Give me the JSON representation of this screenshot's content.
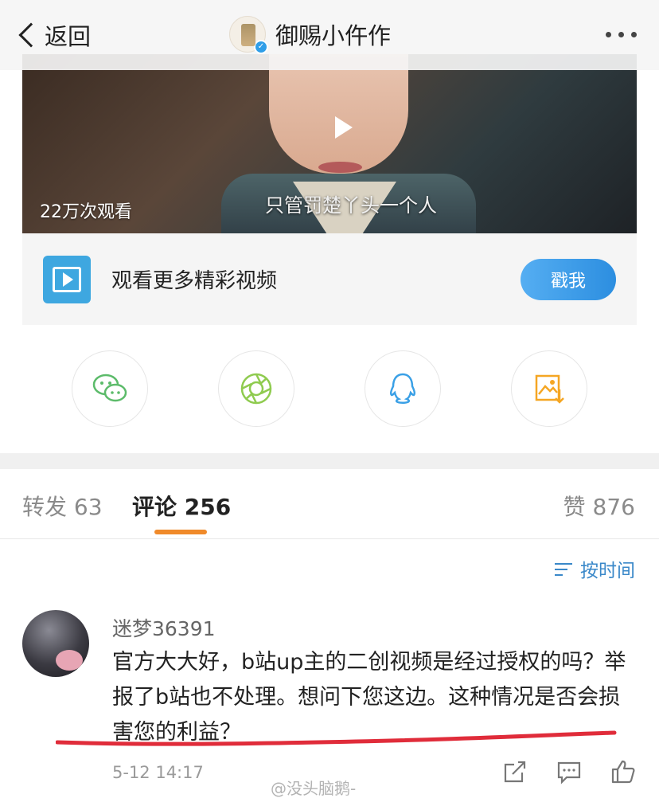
{
  "header": {
    "back_label": "返回",
    "profile_name": "御赐小仵作",
    "avatar_icon": "verified-avatar-icon",
    "more_icon": "more-dots-icon"
  },
  "video": {
    "views": "22万次观看",
    "subtitle": "只管罚楚丫头一个人"
  },
  "promo": {
    "label": "观看更多精彩视频",
    "button": "戳我",
    "icon": "video-icon",
    "accent": "#3ea7e0"
  },
  "share": {
    "items": [
      {
        "icon": "wechat-icon",
        "color": "#5cbb6a"
      },
      {
        "icon": "moments-icon",
        "color": "#8fcb4f"
      },
      {
        "icon": "qq-icon",
        "color": "#3aa0e6"
      },
      {
        "icon": "save-image-icon",
        "color": "#f5a623"
      }
    ]
  },
  "tabs": {
    "repost": "转发 63",
    "comments": "评论 256",
    "likes": "赞 876",
    "active_color": "#f08a2a"
  },
  "sort": {
    "label": "按时间",
    "color": "#3a88c9"
  },
  "comment": {
    "user": "迷梦36391",
    "text": "官方大大好，b站up主的二创视频是经过授权的吗？举报了b站也不处理。想问下您这边。这种情况是否会损害您的利益？",
    "time": "5-12 14:17",
    "highlight_color": "#e02c3a"
  },
  "watermark": "@没头脑鹅-"
}
